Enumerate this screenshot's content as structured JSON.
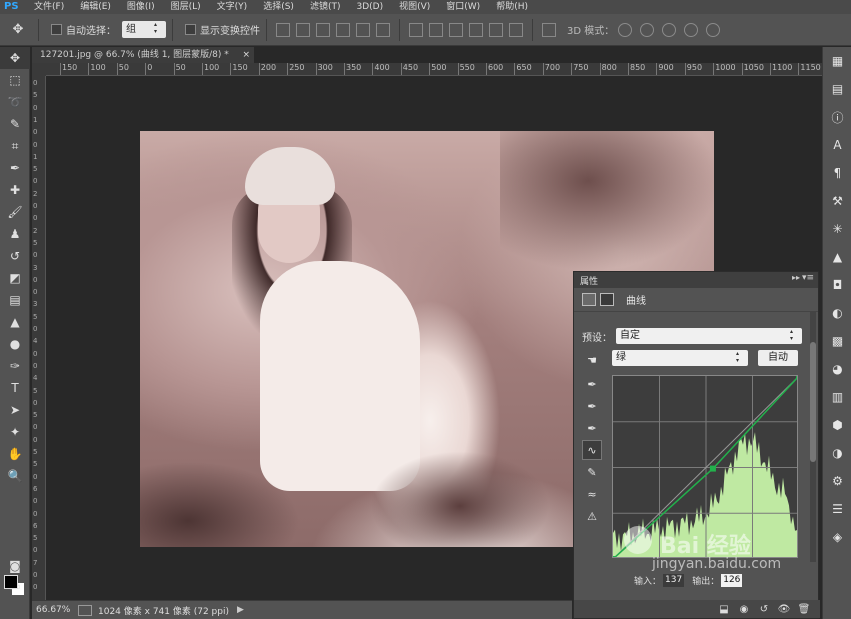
{
  "app": {
    "logo": "PS",
    "menu": [
      "文件(F)",
      "编辑(E)",
      "图像(I)",
      "图层(L)",
      "文字(Y)",
      "选择(S)",
      "滤镜(T)",
      "3D(D)",
      "视图(V)",
      "窗口(W)",
      "帮助(H)"
    ]
  },
  "options": {
    "auto_select_label": "自动选择：",
    "auto_select_value": "组",
    "show_transform_label": "显示变换控件",
    "mode_3d_label": "3D 模式："
  },
  "document": {
    "tab_title": "127201.jpg @ 66.7% (曲线 1, 图层蒙版/8) *",
    "tab_close": "×"
  },
  "ruler": {
    "h_ticks": [
      "150",
      "100",
      "50",
      "0",
      "50",
      "100",
      "150",
      "200",
      "250",
      "300",
      "350",
      "400",
      "450",
      "500",
      "550",
      "600",
      "650",
      "700",
      "750",
      "800",
      "850",
      "900",
      "950",
      "1000",
      "1050",
      "1100",
      "1150"
    ],
    "v_ticks": [
      "0",
      "5",
      "0",
      "1",
      "0",
      "0",
      "1",
      "5",
      "0",
      "2",
      "0",
      "0",
      "2",
      "5",
      "0",
      "3",
      "0",
      "0",
      "3",
      "5",
      "0",
      "4",
      "0",
      "0",
      "4",
      "5",
      "0",
      "5",
      "0",
      "0",
      "5",
      "5",
      "0",
      "6",
      "0",
      "0",
      "6",
      "5",
      "0",
      "7",
      "0",
      "0"
    ]
  },
  "properties": {
    "tab_label": "属性",
    "collapse": "▸▸",
    "menu": "▾≡",
    "adjustment_label": "曲线",
    "preset_label": "预设：",
    "preset_value": "自定",
    "channel_value": "绿",
    "auto_button": "自动",
    "input_label": "输入：",
    "input_value": "137",
    "output_label": "输出：",
    "output_value": "126"
  },
  "curve": {
    "points": [
      [
        0,
        0
      ],
      [
        137,
        126
      ],
      [
        255,
        255
      ]
    ],
    "histogram_color": "#c6f2a8",
    "curve_color": "#22b14c"
  },
  "status": {
    "zoom": "66.67%",
    "doc_info": "1024 像素 x 741 像素 (72 ppi)",
    "arrow": "▶"
  },
  "watermark": {
    "text": "Bai 经验",
    "url": "jingyan.baidu.com"
  }
}
